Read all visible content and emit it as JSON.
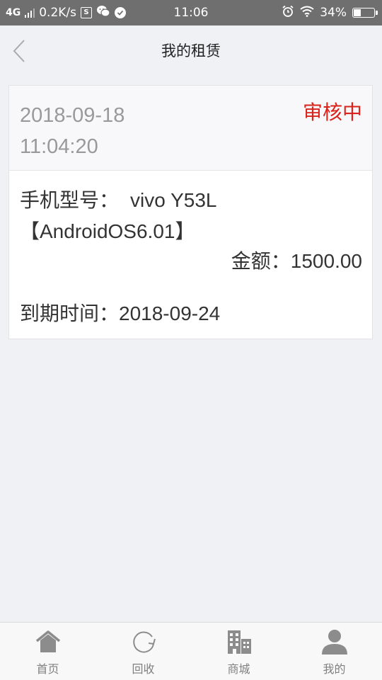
{
  "status_bar": {
    "network_type": "4G",
    "speed": "0.2K/s",
    "sim_badge": "S",
    "time": "11:06",
    "battery_percent": "34%",
    "battery_level": 0.34,
    "icons": [
      "signal-icon",
      "sim-icon",
      "wechat-icon",
      "check-circle-icon",
      "alarm-icon",
      "wifi-icon",
      "battery-icon"
    ]
  },
  "header": {
    "title": "我的租赁",
    "back_icon": "chevron-left-icon"
  },
  "order": {
    "date": "2018-09-18",
    "time": "11:04:20",
    "status": "审核中",
    "status_color": "#d9231b",
    "model_label": "手机型号：",
    "model_value": "vivo Y53L",
    "os_value": "【AndroidOS6.01】",
    "amount_label": "金额：",
    "amount_value": "1500.00",
    "due_label": "到期时间：",
    "due_value": "2018-09-24"
  },
  "bottom_nav": {
    "items": [
      {
        "label": "首页",
        "icon": "home-icon"
      },
      {
        "label": "回收",
        "icon": "recycle-icon"
      },
      {
        "label": "商城",
        "icon": "mall-building-icon"
      },
      {
        "label": "我的",
        "icon": "user-icon"
      }
    ]
  },
  "colors": {
    "background": "#f0f1f5",
    "status_bar": "#6f6f6f",
    "nav_icon": "#8c8c8c"
  }
}
